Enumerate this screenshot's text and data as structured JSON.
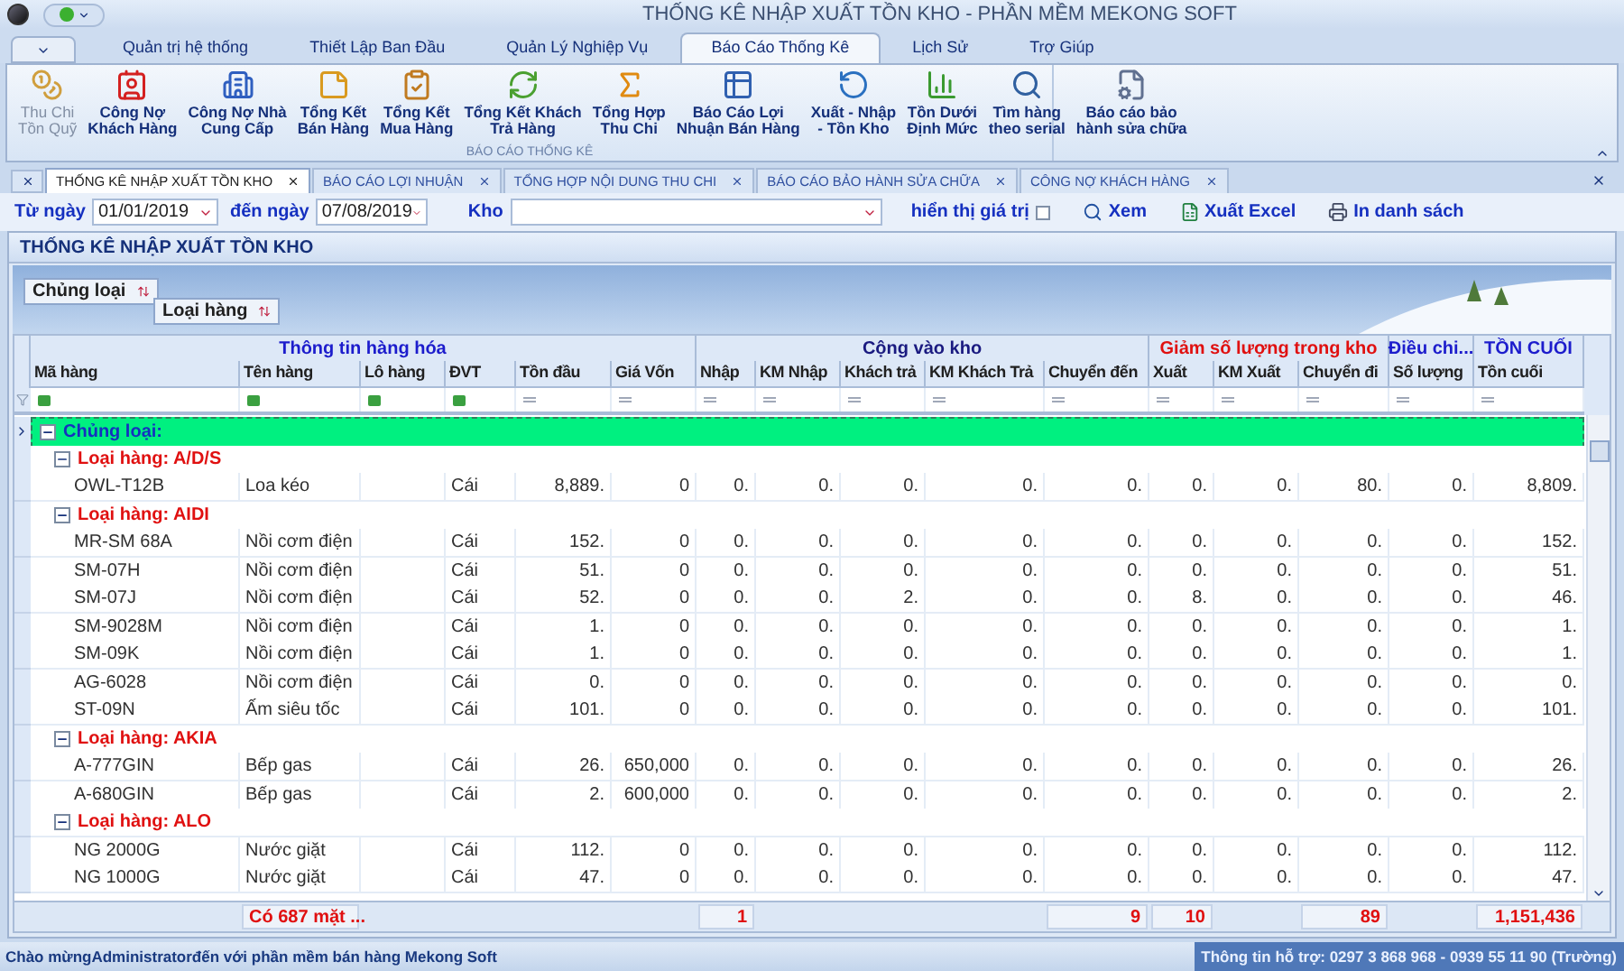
{
  "window": {
    "title": "THỐNG KÊ NHẬP XUẤT TỒN KHO - PHẦN MỀM MEKONG SOFT"
  },
  "ribbon_tabs": [
    {
      "label": "Quản trị hệ thống",
      "selected": false
    },
    {
      "label": "Thiết Lập Ban Đầu",
      "selected": false
    },
    {
      "label": "Quản Lý Nghiệp Vụ",
      "selected": false
    },
    {
      "label": "Báo Cáo Thống Kê",
      "selected": true
    },
    {
      "label": "Lịch Sử",
      "selected": false
    },
    {
      "label": "Trợ Giúp",
      "selected": false
    }
  ],
  "ribbon_buttons": [
    {
      "lines": [
        "Thu Chi",
        "Tồn Quỹ"
      ],
      "disabled": true
    },
    {
      "lines": [
        "Công Nợ",
        "Khách Hàng"
      ],
      "disabled": false
    },
    {
      "lines": [
        "Công Nợ Nhà",
        "Cung Cấp"
      ],
      "disabled": false
    },
    {
      "lines": [
        "Tổng Kết",
        "Bán Hàng"
      ],
      "disabled": false
    },
    {
      "lines": [
        "Tổng Kết",
        "Mua Hàng"
      ],
      "disabled": false
    },
    {
      "lines": [
        "Tổng Kết Khách",
        "Trả Hàng"
      ],
      "disabled": false
    },
    {
      "lines": [
        "Tổng Hợp",
        "Thu Chi"
      ],
      "disabled": false
    },
    {
      "lines": [
        "Báo Cáo Lợi",
        "Nhuận Bán Hàng"
      ],
      "disabled": false
    },
    {
      "lines": [
        "Xuất - Nhập",
        "- Tồn Kho"
      ],
      "disabled": false
    },
    {
      "lines": [
        "Tồn Dưới",
        "Định Mức"
      ],
      "disabled": false
    },
    {
      "lines": [
        "Tìm hàng",
        "theo serial"
      ],
      "disabled": false
    },
    {
      "lines": [
        "Báo cáo bảo",
        "hành sửa chữa"
      ],
      "disabled": false
    }
  ],
  "ribbon_group": "BÁO CÁO THỐNG KÊ",
  "document_tabs": [
    {
      "label": "THỐNG KÊ NHẬP XUẤT TỒN KHO",
      "selected": true
    },
    {
      "label": "BÁO CÁO LỢI NHUẬN",
      "selected": false
    },
    {
      "label": "TỔNG HỢP NỘI DUNG THU CHI",
      "selected": false
    },
    {
      "label": "BÁO CÁO BẢO HÀNH SỬA CHỮA",
      "selected": false
    },
    {
      "label": "CÔNG NỢ KHÁCH HÀNG",
      "selected": false
    }
  ],
  "toolbar": {
    "from_label": "Từ ngày",
    "from_date": "01/01/2019",
    "to_label": "đến ngày",
    "to_date": "07/08/2019",
    "warehouse_label": "Kho",
    "show_values": {
      "label": "hiển thị giá trị",
      "checked": false
    },
    "buttons": [
      "Xem",
      "Xuất Excel",
      "In danh sách"
    ]
  },
  "panel_title": "THỐNG KÊ NHẬP XUẤT TỒN KHO",
  "group_by": [
    "Chủng loại",
    "Loại hàng"
  ],
  "grid": {
    "bands": [
      {
        "label": "Thông tin hàng hóa",
        "color": "#1c1ccc",
        "columns": [
          "Mã hàng",
          "Tên hàng",
          "Lô hàng",
          "ĐVT",
          "Tồn đầu",
          "Giá Vốn"
        ]
      },
      {
        "label": "Cộng vào kho",
        "color": "#1a1a80",
        "columns": [
          "Nhập",
          "KM Nhập",
          "Khách trả",
          "KM Khách Trả",
          "Chuyển đến"
        ]
      },
      {
        "label": "Giảm số lượng trong kho",
        "color": "#e01010",
        "columns": [
          "Xuất",
          "KM Xuất",
          "Chuyển đi"
        ]
      },
      {
        "label": "Điều chi...",
        "color": "#1c1ccc",
        "columns": [
          "Số lượng"
        ]
      },
      {
        "label": "TỒN CUỐI",
        "color": "#1c1ccc",
        "columns": [
          "Tồn cuối"
        ]
      }
    ],
    "groups": [
      {
        "label": "Chủng loại:",
        "expanded": true,
        "selected": true,
        "children": [
          {
            "label": "Loại hàng: A/D/S",
            "expanded": true,
            "selected": false,
            "rows": [
              {
                "ma_hang": "OWL-T12B",
                "ten_hang": "Loa kéo",
                "dvt": "Cái",
                "ton_dau": "8,889.",
                "gia_von": "0",
                "nhap": "0.",
                "km_nhap": "0.",
                "khach_tra": "0.",
                "km_khach_tra": "0.",
                "chuyen_den": "0.",
                "xuat": "0.",
                "km_xuat": "0.",
                "chuyen_di": "80.",
                "so_luong": "0.",
                "ton_cuoi": "8,809."
              }
            ]
          },
          {
            "label": "Loại hàng: AIDI",
            "expanded": true,
            "selected": false,
            "rows": [
              {
                "ma_hang": "MR-SM 68A",
                "ten_hang": "Nồi cơm điện",
                "dvt": "Cái",
                "ton_dau": "152.",
                "gia_von": "0",
                "nhap": "0.",
                "km_nhap": "0.",
                "khach_tra": "0.",
                "km_khach_tra": "0.",
                "chuyen_den": "0.",
                "xuat": "0.",
                "km_xuat": "0.",
                "chuyen_di": "0.",
                "so_luong": "0.",
                "ton_cuoi": "152."
              },
              {
                "ma_hang": "SM-07H",
                "ten_hang": "Nồi cơm điện",
                "dvt": "Cái",
                "ton_dau": "51.",
                "gia_von": "0",
                "nhap": "0.",
                "km_nhap": "0.",
                "khach_tra": "0.",
                "km_khach_tra": "0.",
                "chuyen_den": "0.",
                "xuat": "0.",
                "km_xuat": "0.",
                "chuyen_di": "0.",
                "so_luong": "0.",
                "ton_cuoi": "51."
              },
              {
                "ma_hang": "SM-07J",
                "ten_hang": "Nồi cơm điện",
                "dvt": "Cái",
                "ton_dau": "52.",
                "gia_von": "0",
                "nhap": "0.",
                "km_nhap": "0.",
                "khach_tra": "2.",
                "km_khach_tra": "0.",
                "chuyen_den": "0.",
                "xuat": "8.",
                "km_xuat": "0.",
                "chuyen_di": "0.",
                "so_luong": "0.",
                "ton_cuoi": "46."
              },
              {
                "ma_hang": "SM-9028M",
                "ten_hang": "Nồi cơm điện",
                "dvt": "Cái",
                "ton_dau": "1.",
                "gia_von": "0",
                "nhap": "0.",
                "km_nhap": "0.",
                "khach_tra": "0.",
                "km_khach_tra": "0.",
                "chuyen_den": "0.",
                "xuat": "0.",
                "km_xuat": "0.",
                "chuyen_di": "0.",
                "so_luong": "0.",
                "ton_cuoi": "1."
              },
              {
                "ma_hang": "SM-09K",
                "ten_hang": "Nồi cơm điện",
                "dvt": "Cái",
                "ton_dau": "1.",
                "gia_von": "0",
                "nhap": "0.",
                "km_nhap": "0.",
                "khach_tra": "0.",
                "km_khach_tra": "0.",
                "chuyen_den": "0.",
                "xuat": "0.",
                "km_xuat": "0.",
                "chuyen_di": "0.",
                "so_luong": "0.",
                "ton_cuoi": "1."
              },
              {
                "ma_hang": "AG-6028",
                "ten_hang": "Nồi cơm điện",
                "dvt": "Cái",
                "ton_dau": "0.",
                "gia_von": "0",
                "nhap": "0.",
                "km_nhap": "0.",
                "khach_tra": "0.",
                "km_khach_tra": "0.",
                "chuyen_den": "0.",
                "xuat": "0.",
                "km_xuat": "0.",
                "chuyen_di": "0.",
                "so_luong": "0.",
                "ton_cuoi": "0."
              },
              {
                "ma_hang": "ST-09N",
                "ten_hang": "Ấm siêu tốc",
                "dvt": "Cái",
                "ton_dau": "101.",
                "gia_von": "0",
                "nhap": "0.",
                "km_nhap": "0.",
                "khach_tra": "0.",
                "km_khach_tra": "0.",
                "chuyen_den": "0.",
                "xuat": "0.",
                "km_xuat": "0.",
                "chuyen_di": "0.",
                "so_luong": "0.",
                "ton_cuoi": "101."
              }
            ]
          },
          {
            "label": "Loại hàng: AKIA",
            "expanded": true,
            "selected": false,
            "rows": [
              {
                "ma_hang": "A-777GIN",
                "ten_hang": "Bếp gas",
                "dvt": "Cái",
                "ton_dau": "26.",
                "gia_von": "650,000",
                "nhap": "0.",
                "km_nhap": "0.",
                "khach_tra": "0.",
                "km_khach_tra": "0.",
                "chuyen_den": "0.",
                "xuat": "0.",
                "km_xuat": "0.",
                "chuyen_di": "0.",
                "so_luong": "0.",
                "ton_cuoi": "26."
              },
              {
                "ma_hang": "A-680GIN",
                "ten_hang": "Bếp gas",
                "dvt": "Cái",
                "ton_dau": "2.",
                "gia_von": "600,000",
                "nhap": "0.",
                "km_nhap": "0.",
                "khach_tra": "0.",
                "km_khach_tra": "0.",
                "chuyen_den": "0.",
                "xuat": "0.",
                "km_xuat": "0.",
                "chuyen_di": "0.",
                "so_luong": "0.",
                "ton_cuoi": "2."
              }
            ]
          },
          {
            "label": "Loại hàng: ALO",
            "expanded": true,
            "selected": false,
            "rows": [
              {
                "ma_hang": "NG 2000G",
                "ten_hang": "Nước giặt",
                "dvt": "Cái",
                "ton_dau": "112.",
                "gia_von": "0",
                "nhap": "0.",
                "km_nhap": "0.",
                "khach_tra": "0.",
                "km_khach_tra": "0.",
                "chuyen_den": "0.",
                "xuat": "0.",
                "km_xuat": "0.",
                "chuyen_di": "0.",
                "so_luong": "0.",
                "ton_cuoi": "112."
              },
              {
                "ma_hang": "NG 1000G",
                "ten_hang": "Nước giặt",
                "dvt": "Cái",
                "ton_dau": "47.",
                "gia_von": "0",
                "nhap": "0.",
                "km_nhap": "0.",
                "khach_tra": "0.",
                "km_khach_tra": "0.",
                "chuyen_den": "0.",
                "xuat": "0.",
                "km_xuat": "0.",
                "chuyen_di": "0.",
                "so_luong": "0.",
                "ton_cuoi": "47."
              }
            ]
          }
        ]
      }
    ],
    "footer": {
      "ten_hang": "Có 687 mặt ...",
      "nhap": "1",
      "chuyen_den": "9",
      "xuat": "10",
      "chuyen_di": "89",
      "ton_cuoi": "1,151,436"
    }
  },
  "status_bar": {
    "left": "Chào mừngAdministratorđến với phần mềm bán hàng Mekong Soft",
    "right": "Thông tin hỗ trợ: 0297 3 868 968 - 0939 55 11 90 (Trường)"
  }
}
